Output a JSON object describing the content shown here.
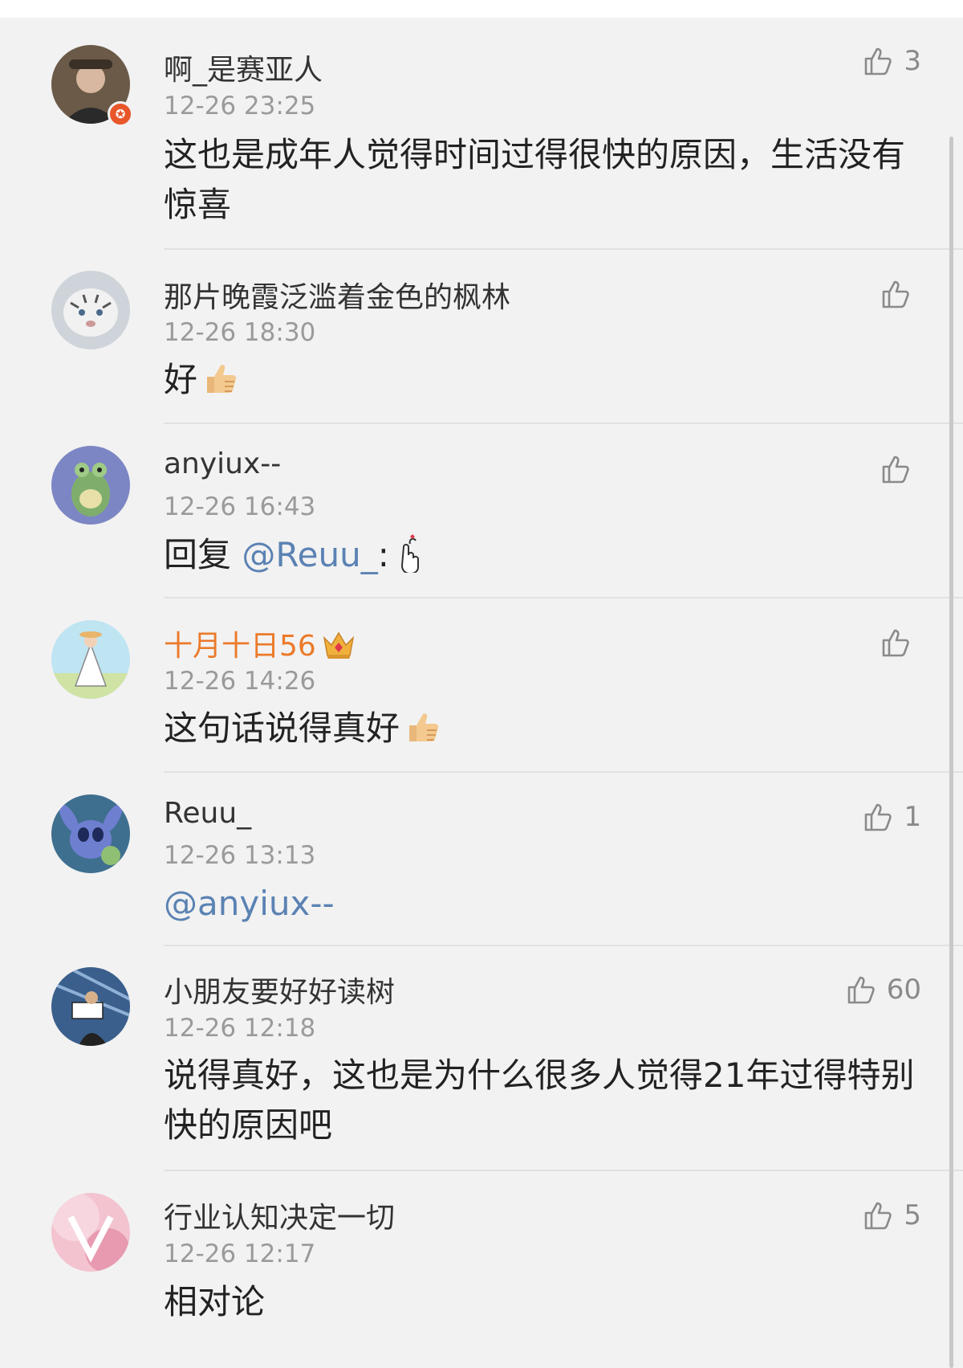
{
  "comments": [
    {
      "user": "啊_是赛亚人",
      "time": "12-26 23:25",
      "text": "这也是成年人觉得时间过得很快的原因，生活没有惊喜",
      "likes": "3",
      "verified_badge": true
    },
    {
      "user": "那片晚霞泛滥着金色的枫林",
      "time": "12-26 18:30",
      "text": "好",
      "likes": "",
      "emoji": "thumbs-up-emoji"
    },
    {
      "user": "anyiux--",
      "time": "12-26 16:43",
      "reply_prefix": "回复 ",
      "mention": "@Reuu_",
      "reply_suffix": ":",
      "likes": "",
      "emoji": "finger-heart-emoji"
    },
    {
      "user": "十月十日56",
      "time": "12-26 14:26",
      "text": "这句话说得真好",
      "likes": "",
      "vip": true,
      "emoji": "thumbs-up-emoji"
    },
    {
      "user": "Reuu_",
      "time": "12-26 13:13",
      "mention": "@anyiux--",
      "likes": "1"
    },
    {
      "user": "小朋友要好好读树",
      "time": "12-26 12:18",
      "text": "说得真好，这也是为什么很多人觉得21年过得特别快的原因吧",
      "likes": "60"
    },
    {
      "user": "行业认知决定一切",
      "time": "12-26 12:17",
      "text": "相对论",
      "likes": "5"
    }
  ],
  "colors": {
    "name": "#333333",
    "vip_name": "#eb7a2a",
    "mention": "#5b82b3",
    "time": "#9a9a9a",
    "background": "#f2f2f2"
  },
  "icons": {
    "like": "thumb-up-outline-icon",
    "verified": "star-badge-icon",
    "vip": "crown-icon"
  }
}
